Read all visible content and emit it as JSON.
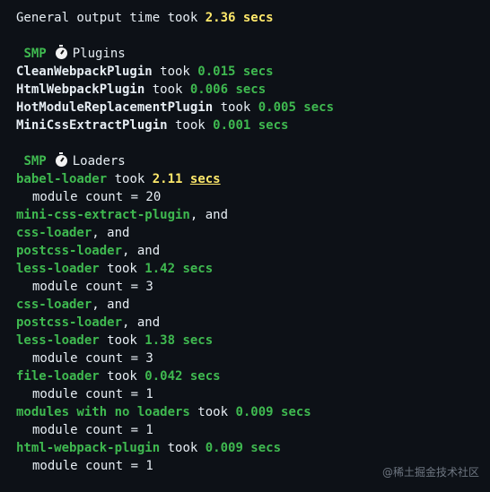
{
  "header": {
    "prefix": "General output time took ",
    "value": "2.36 secs"
  },
  "plugins_section": {
    "tag": "SMP",
    "icon": "stopwatch-icon",
    "title": "Plugins",
    "items": [
      {
        "name": "CleanWebpackPlugin",
        "took": " took ",
        "time": "0.015 secs"
      },
      {
        "name": "HtmlWebpackPlugin",
        "took": " took ",
        "time": "0.006 secs"
      },
      {
        "name": "HotModuleReplacementPlugin",
        "took": " took ",
        "time": "0.005 secs"
      },
      {
        "name": "MiniCssExtractPlugin",
        "took": " took ",
        "time": "0.001 secs"
      }
    ]
  },
  "loaders_section": {
    "tag": "SMP",
    "icon": "stopwatch-icon",
    "title": "Loaders",
    "babel": {
      "name": "babel-loader",
      "took": " took ",
      "time_value": "2.11",
      "time_unit": "secs",
      "count": "module count = 20"
    },
    "chain1": [
      {
        "name": "mini-css-extract-plugin",
        "sep": ", and"
      },
      {
        "name": "css-loader",
        "sep": ", and"
      },
      {
        "name": "postcss-loader",
        "sep": ", and"
      }
    ],
    "less1": {
      "name": "less-loader",
      "took": " took ",
      "time": "1.42 secs",
      "count": "module count = 3"
    },
    "chain2": [
      {
        "name": "css-loader",
        "sep": ", and"
      },
      {
        "name": "postcss-loader",
        "sep": ", and"
      }
    ],
    "less2": {
      "name": "less-loader",
      "took": " took ",
      "time": "1.38 secs",
      "count": "module count = 3"
    },
    "file": {
      "name": "file-loader",
      "took": " took ",
      "time": "0.042 secs",
      "count": "module count = 1"
    },
    "noloaders": {
      "name": "modules with no loaders",
      "took": " took ",
      "time": "0.009 secs",
      "count": "module count = 1"
    },
    "html": {
      "name": "html-webpack-plugin",
      "took": " took ",
      "time": "0.009 secs",
      "count": "module count = 1"
    }
  },
  "watermark": "@稀土掘金技术社区",
  "colors": {
    "background": "#0d1117",
    "green": "#3fb950",
    "yellow": "#ffe96b",
    "text": "#e6edf3"
  }
}
